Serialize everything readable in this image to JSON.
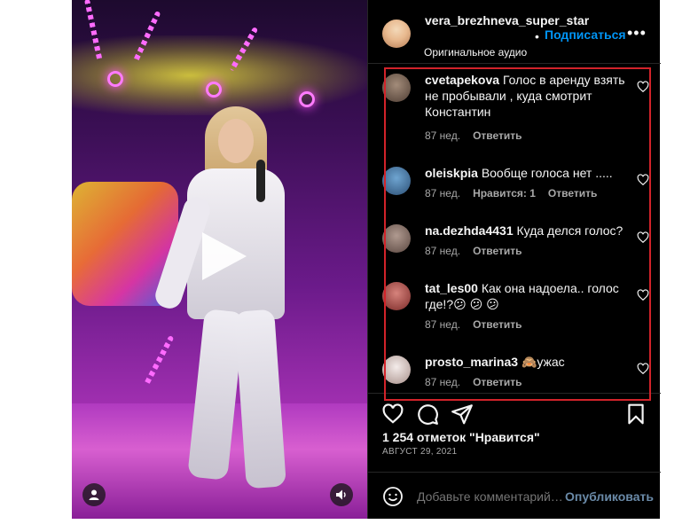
{
  "header": {
    "username": "vera_brezhneva_super_star",
    "separator": "•",
    "follow_label": "Подписаться",
    "more_label": "•••",
    "audio_label": "Оригинальное аудио"
  },
  "comments": [
    {
      "user": "cvetapekova",
      "text": "Голос в аренду взять не пробывали , куда смотрит Константин",
      "age": "87 нед.",
      "likes": "",
      "reply": "Ответить",
      "avatar_color": "#6b5a4e"
    },
    {
      "user": "oleiskpia",
      "text": "Вообще голоса нет .....",
      "age": "87 нед.",
      "likes": "Нравится: 1",
      "reply": "Ответить",
      "avatar_color": "#3a6d9a"
    },
    {
      "user": "na.dezhda4431",
      "text": "Куда делся голос?",
      "age": "87 нед.",
      "likes": "",
      "reply": "Ответить",
      "avatar_color": "#7d6a62"
    },
    {
      "user": "tat_les00",
      "text": "Как она надоела.. голос где!?😕 😕 😕",
      "age": "87 нед.",
      "likes": "",
      "reply": "Ответить",
      "avatar_color": "#b04a46"
    },
    {
      "user": "prosto_marina3",
      "text": "🙈ужас",
      "age": "87 нед.",
      "likes": "",
      "reply": "Ответить",
      "avatar_color": "#d9c8c2"
    }
  ],
  "likes_text": "1 254 отметок \"Нравится\"",
  "date_text": "АВГУСТ 29, 2021",
  "add_comment": {
    "placeholder": "Добавьте комментарий…",
    "publish_label": "Опубликовать"
  },
  "colors": {
    "accent": "#0095f6",
    "highlight": "#d2232a",
    "background": "#000000"
  }
}
